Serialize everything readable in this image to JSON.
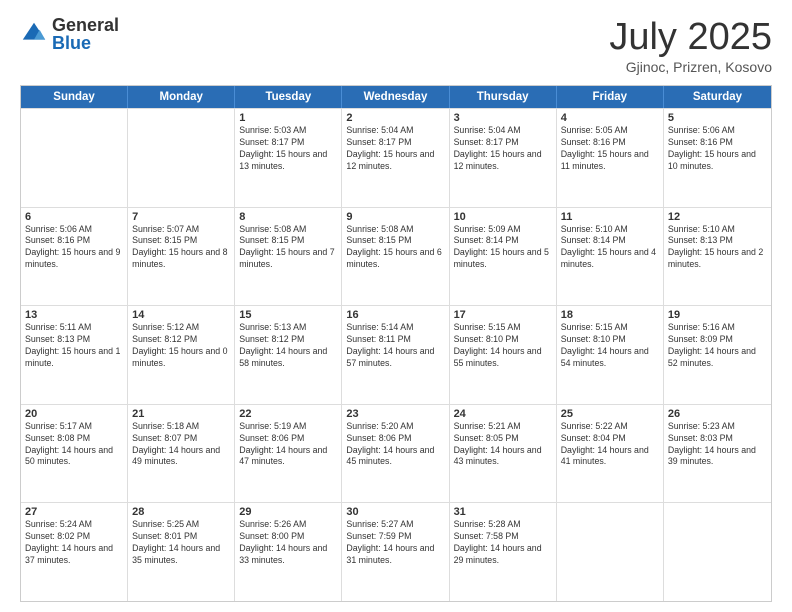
{
  "logo": {
    "general": "General",
    "blue": "Blue"
  },
  "title": {
    "month": "July 2025",
    "location": "Gjinoc, Prizren, Kosovo"
  },
  "header_days": [
    "Sunday",
    "Monday",
    "Tuesday",
    "Wednesday",
    "Thursday",
    "Friday",
    "Saturday"
  ],
  "rows": [
    [
      {
        "day": "",
        "info": ""
      },
      {
        "day": "",
        "info": ""
      },
      {
        "day": "1",
        "info": "Sunrise: 5:03 AM\nSunset: 8:17 PM\nDaylight: 15 hours and 13 minutes."
      },
      {
        "day": "2",
        "info": "Sunrise: 5:04 AM\nSunset: 8:17 PM\nDaylight: 15 hours and 12 minutes."
      },
      {
        "day": "3",
        "info": "Sunrise: 5:04 AM\nSunset: 8:17 PM\nDaylight: 15 hours and 12 minutes."
      },
      {
        "day": "4",
        "info": "Sunrise: 5:05 AM\nSunset: 8:16 PM\nDaylight: 15 hours and 11 minutes."
      },
      {
        "day": "5",
        "info": "Sunrise: 5:06 AM\nSunset: 8:16 PM\nDaylight: 15 hours and 10 minutes."
      }
    ],
    [
      {
        "day": "6",
        "info": "Sunrise: 5:06 AM\nSunset: 8:16 PM\nDaylight: 15 hours and 9 minutes."
      },
      {
        "day": "7",
        "info": "Sunrise: 5:07 AM\nSunset: 8:15 PM\nDaylight: 15 hours and 8 minutes."
      },
      {
        "day": "8",
        "info": "Sunrise: 5:08 AM\nSunset: 8:15 PM\nDaylight: 15 hours and 7 minutes."
      },
      {
        "day": "9",
        "info": "Sunrise: 5:08 AM\nSunset: 8:15 PM\nDaylight: 15 hours and 6 minutes."
      },
      {
        "day": "10",
        "info": "Sunrise: 5:09 AM\nSunset: 8:14 PM\nDaylight: 15 hours and 5 minutes."
      },
      {
        "day": "11",
        "info": "Sunrise: 5:10 AM\nSunset: 8:14 PM\nDaylight: 15 hours and 4 minutes."
      },
      {
        "day": "12",
        "info": "Sunrise: 5:10 AM\nSunset: 8:13 PM\nDaylight: 15 hours and 2 minutes."
      }
    ],
    [
      {
        "day": "13",
        "info": "Sunrise: 5:11 AM\nSunset: 8:13 PM\nDaylight: 15 hours and 1 minute."
      },
      {
        "day": "14",
        "info": "Sunrise: 5:12 AM\nSunset: 8:12 PM\nDaylight: 15 hours and 0 minutes."
      },
      {
        "day": "15",
        "info": "Sunrise: 5:13 AM\nSunset: 8:12 PM\nDaylight: 14 hours and 58 minutes."
      },
      {
        "day": "16",
        "info": "Sunrise: 5:14 AM\nSunset: 8:11 PM\nDaylight: 14 hours and 57 minutes."
      },
      {
        "day": "17",
        "info": "Sunrise: 5:15 AM\nSunset: 8:10 PM\nDaylight: 14 hours and 55 minutes."
      },
      {
        "day": "18",
        "info": "Sunrise: 5:15 AM\nSunset: 8:10 PM\nDaylight: 14 hours and 54 minutes."
      },
      {
        "day": "19",
        "info": "Sunrise: 5:16 AM\nSunset: 8:09 PM\nDaylight: 14 hours and 52 minutes."
      }
    ],
    [
      {
        "day": "20",
        "info": "Sunrise: 5:17 AM\nSunset: 8:08 PM\nDaylight: 14 hours and 50 minutes."
      },
      {
        "day": "21",
        "info": "Sunrise: 5:18 AM\nSunset: 8:07 PM\nDaylight: 14 hours and 49 minutes."
      },
      {
        "day": "22",
        "info": "Sunrise: 5:19 AM\nSunset: 8:06 PM\nDaylight: 14 hours and 47 minutes."
      },
      {
        "day": "23",
        "info": "Sunrise: 5:20 AM\nSunset: 8:06 PM\nDaylight: 14 hours and 45 minutes."
      },
      {
        "day": "24",
        "info": "Sunrise: 5:21 AM\nSunset: 8:05 PM\nDaylight: 14 hours and 43 minutes."
      },
      {
        "day": "25",
        "info": "Sunrise: 5:22 AM\nSunset: 8:04 PM\nDaylight: 14 hours and 41 minutes."
      },
      {
        "day": "26",
        "info": "Sunrise: 5:23 AM\nSunset: 8:03 PM\nDaylight: 14 hours and 39 minutes."
      }
    ],
    [
      {
        "day": "27",
        "info": "Sunrise: 5:24 AM\nSunset: 8:02 PM\nDaylight: 14 hours and 37 minutes."
      },
      {
        "day": "28",
        "info": "Sunrise: 5:25 AM\nSunset: 8:01 PM\nDaylight: 14 hours and 35 minutes."
      },
      {
        "day": "29",
        "info": "Sunrise: 5:26 AM\nSunset: 8:00 PM\nDaylight: 14 hours and 33 minutes."
      },
      {
        "day": "30",
        "info": "Sunrise: 5:27 AM\nSunset: 7:59 PM\nDaylight: 14 hours and 31 minutes."
      },
      {
        "day": "31",
        "info": "Sunrise: 5:28 AM\nSunset: 7:58 PM\nDaylight: 14 hours and 29 minutes."
      },
      {
        "day": "",
        "info": ""
      },
      {
        "day": "",
        "info": ""
      }
    ]
  ]
}
